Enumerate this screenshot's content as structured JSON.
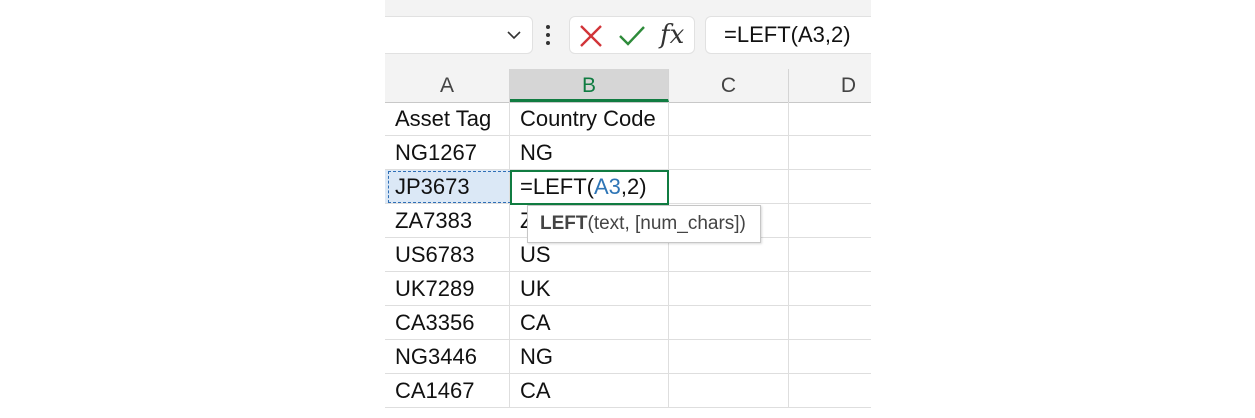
{
  "formula_bar": {
    "formula": "=LEFT(A3,2)",
    "fx_label": "fx"
  },
  "columns": [
    "A",
    "B",
    "C",
    "D"
  ],
  "rows": [
    {
      "a": "Asset Tag",
      "b": "Country Code"
    },
    {
      "a": "NG1267",
      "b": "NG"
    },
    {
      "a": "JP3673",
      "b_prefix": "=LEFT(",
      "b_ref": "A3",
      "b_suffix": ",2)"
    },
    {
      "a": "ZA7383",
      "b": "Z"
    },
    {
      "a": "US6783",
      "b": "US"
    },
    {
      "a": "UK7289",
      "b": "UK"
    },
    {
      "a": "CA3356",
      "b": "CA"
    },
    {
      "a": "NG3446",
      "b": "NG"
    },
    {
      "a": "CA1467",
      "b": "CA"
    }
  ],
  "tooltip": {
    "function_name": "LEFT",
    "args": "(text, [num_chars])"
  },
  "colors": {
    "active_green": "#107c41",
    "reference_blue": "#2e75b6",
    "cancel_red": "#d13438"
  }
}
